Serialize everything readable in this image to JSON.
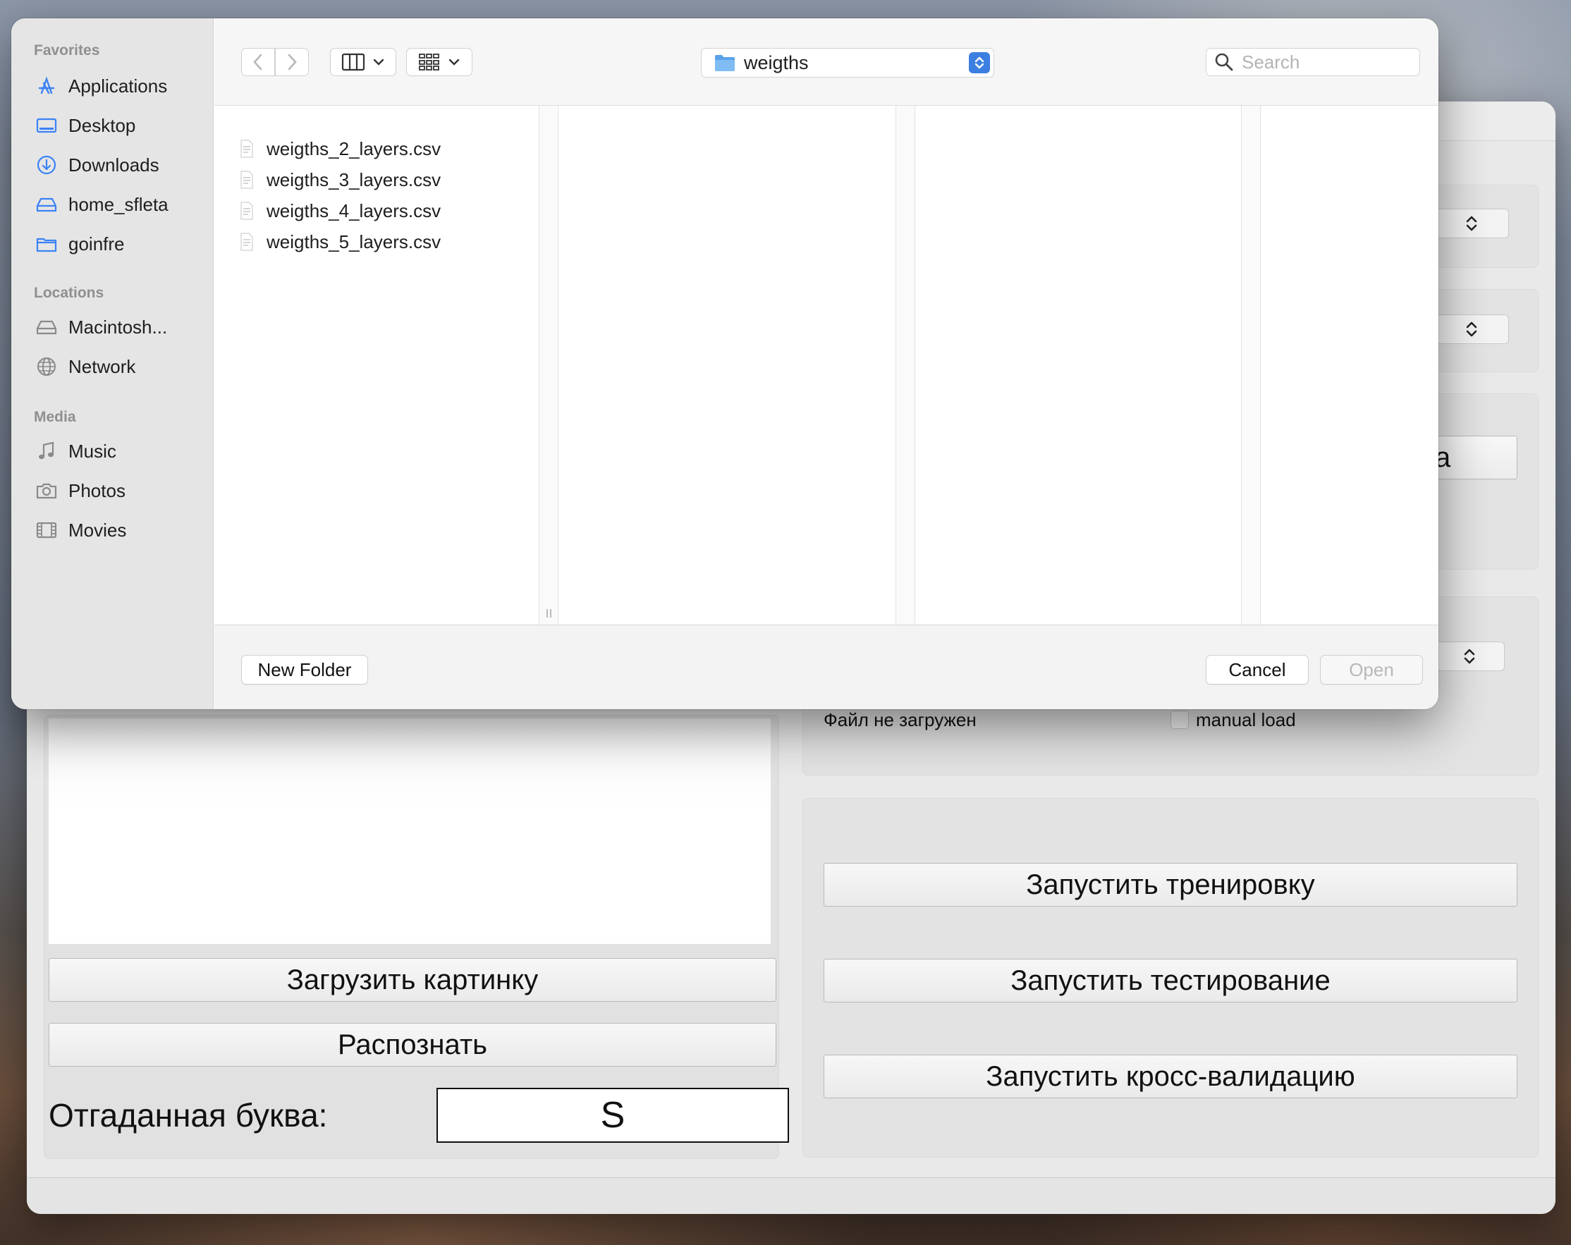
{
  "dialog": {
    "sidebar": {
      "favorites_header": "Favorites",
      "favorites": [
        {
          "label": "Applications",
          "icon": "applications-icon"
        },
        {
          "label": "Desktop",
          "icon": "desktop-icon"
        },
        {
          "label": "Downloads",
          "icon": "downloads-icon"
        },
        {
          "label": "home_sfleta",
          "icon": "drive-icon"
        },
        {
          "label": "goinfre",
          "icon": "folder-icon"
        }
      ],
      "locations_header": "Locations",
      "locations": [
        {
          "label": "Macintosh...",
          "icon": "hard-disk-icon"
        },
        {
          "label": "Network",
          "icon": "globe-icon"
        }
      ],
      "media_header": "Media",
      "media": [
        {
          "label": "Music",
          "icon": "music-note-icon"
        },
        {
          "label": "Photos",
          "icon": "camera-icon"
        },
        {
          "label": "Movies",
          "icon": "film-icon"
        }
      ]
    },
    "toolbar": {
      "current_folder": "weigths",
      "search_placeholder": "Search"
    },
    "files": [
      "weigths_2_layers.csv",
      "weigths_3_layers.csv",
      "weigths_4_layers.csv",
      "weigths_5_layers.csv"
    ],
    "footer": {
      "new_folder": "New Folder",
      "cancel": "Cancel",
      "open": "Open"
    }
  },
  "app": {
    "load_image_button": "Загрузить картинку",
    "recognize_button": "Распознать",
    "guessed_letter_label": "Отгаданная буква:",
    "guessed_letter_value": "S",
    "partial_button_tail": "а",
    "file_status": "Файл не загружен",
    "manual_load_label": "manual load",
    "train_button": "Запустить тренировку",
    "test_button": "Запустить тестирование",
    "crossval_button": "Запустить кросс-валидацию"
  },
  "colors": {
    "accent": "#3c7fe0",
    "sidebar_bg": "#e5e5e5",
    "icon_blue": "#3b82f6"
  }
}
